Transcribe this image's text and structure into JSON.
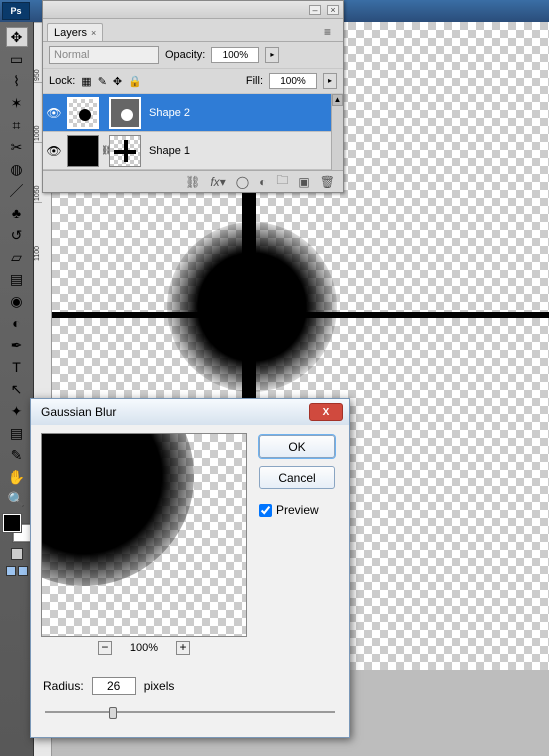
{
  "app": {
    "logo_text": "Ps"
  },
  "toolbox": {
    "tools": [
      "move",
      "marquee",
      "lasso",
      "wand",
      "crop",
      "slice",
      "healing",
      "brush",
      "stamp",
      "history-brush",
      "eraser",
      "gradient",
      "blur",
      "dodge",
      "pen",
      "type",
      "path-select",
      "custom-shape",
      "notes",
      "eyedropper",
      "hand",
      "zoom"
    ]
  },
  "ruler_marks": [
    "950",
    "1000",
    "1050",
    "1100"
  ],
  "layers_panel": {
    "tab_label": "Layers",
    "blend_mode": "Normal",
    "opacity_label": "Opacity:",
    "opacity_value": "100%",
    "lock_label": "Lock:",
    "fill_label": "Fill:",
    "fill_value": "100%",
    "layers": [
      {
        "name": "Shape 2"
      },
      {
        "name": "Shape 1"
      }
    ]
  },
  "dialog": {
    "title": "Gaussian Blur",
    "ok": "OK",
    "cancel": "Cancel",
    "preview": "Preview",
    "preview_checked": true,
    "zoom_value": "100%",
    "radius_label": "Radius:",
    "radius_value": "26",
    "radius_unit": "pixels"
  }
}
